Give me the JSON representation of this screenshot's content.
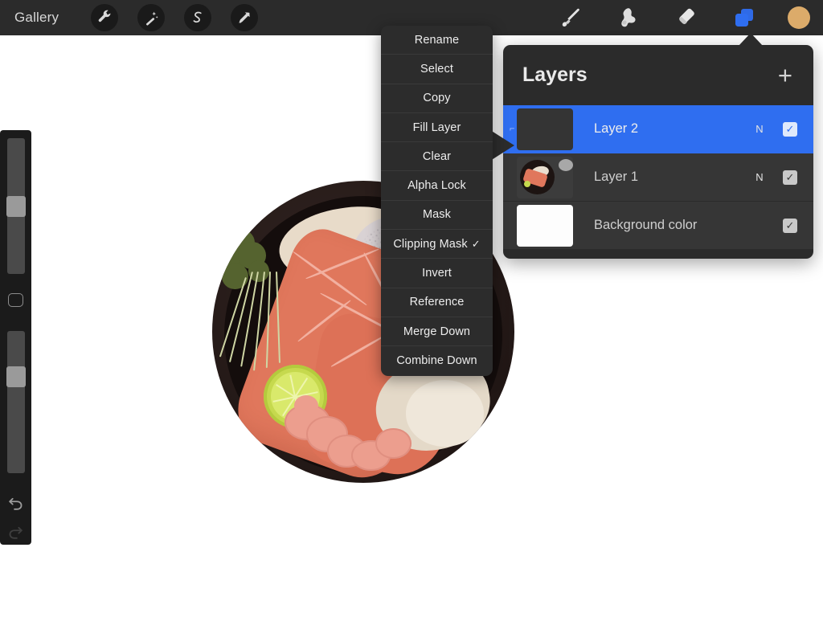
{
  "topbar": {
    "gallery_label": "Gallery",
    "left_tools": [
      {
        "name": "wrench-icon",
        "label": "Actions"
      },
      {
        "name": "magic-wand-icon",
        "label": "Adjustments"
      },
      {
        "name": "selection-icon",
        "label": "Selection"
      },
      {
        "name": "transform-arrow-icon",
        "label": "Transform"
      }
    ],
    "right_tools": [
      {
        "name": "paintbrush-icon",
        "label": "Paint"
      },
      {
        "name": "smudge-icon",
        "label": "Smudge"
      },
      {
        "name": "eraser-icon",
        "label": "Erase"
      },
      {
        "name": "layers-icon",
        "label": "Layers",
        "active": true
      }
    ],
    "color_swatch": "#dcab6a"
  },
  "sidebar": {
    "brush_size_label": "Brush size",
    "brush_size_percent": 42,
    "modify_label": "Modify",
    "opacity_label": "Opacity",
    "opacity_percent": 62,
    "undo_label": "Undo",
    "redo_label": "Redo"
  },
  "context_menu": {
    "items": [
      {
        "label": "Rename",
        "checked": false
      },
      {
        "label": "Select",
        "checked": false
      },
      {
        "label": "Copy",
        "checked": false
      },
      {
        "label": "Fill Layer",
        "checked": false
      },
      {
        "label": "Clear",
        "checked": false
      },
      {
        "label": "Alpha Lock",
        "checked": false
      },
      {
        "label": "Mask",
        "checked": false
      },
      {
        "label": "Clipping Mask",
        "checked": true
      },
      {
        "label": "Invert",
        "checked": false
      },
      {
        "label": "Reference",
        "checked": false
      },
      {
        "label": "Merge Down",
        "checked": false
      },
      {
        "label": "Combine Down",
        "checked": false
      }
    ],
    "check_glyph": "✓"
  },
  "layers_panel": {
    "title": "Layers",
    "add_label": "+",
    "rows": [
      {
        "name": "Layer 2",
        "blend": "N",
        "visible": true,
        "selected": true,
        "thumb": "empty",
        "clipped": true
      },
      {
        "name": "Layer 1",
        "blend": "N",
        "visible": true,
        "selected": false,
        "thumb": "artwork",
        "clipped": false
      },
      {
        "name": "Background color",
        "blend": "",
        "visible": true,
        "selected": false,
        "thumb": "white",
        "clipped": false
      }
    ],
    "check_glyph": "✓",
    "accent_color": "#2f6ef0"
  },
  "artwork": {
    "title": "Sushi plate illustration",
    "plate_color": "#1d1412",
    "salmon_color": "#e0775c",
    "rice_color": "#e8dbc9",
    "lime_color": "#c6d94e",
    "greens_color": "#55632f",
    "shrimp_color": "#ec9e8e"
  }
}
